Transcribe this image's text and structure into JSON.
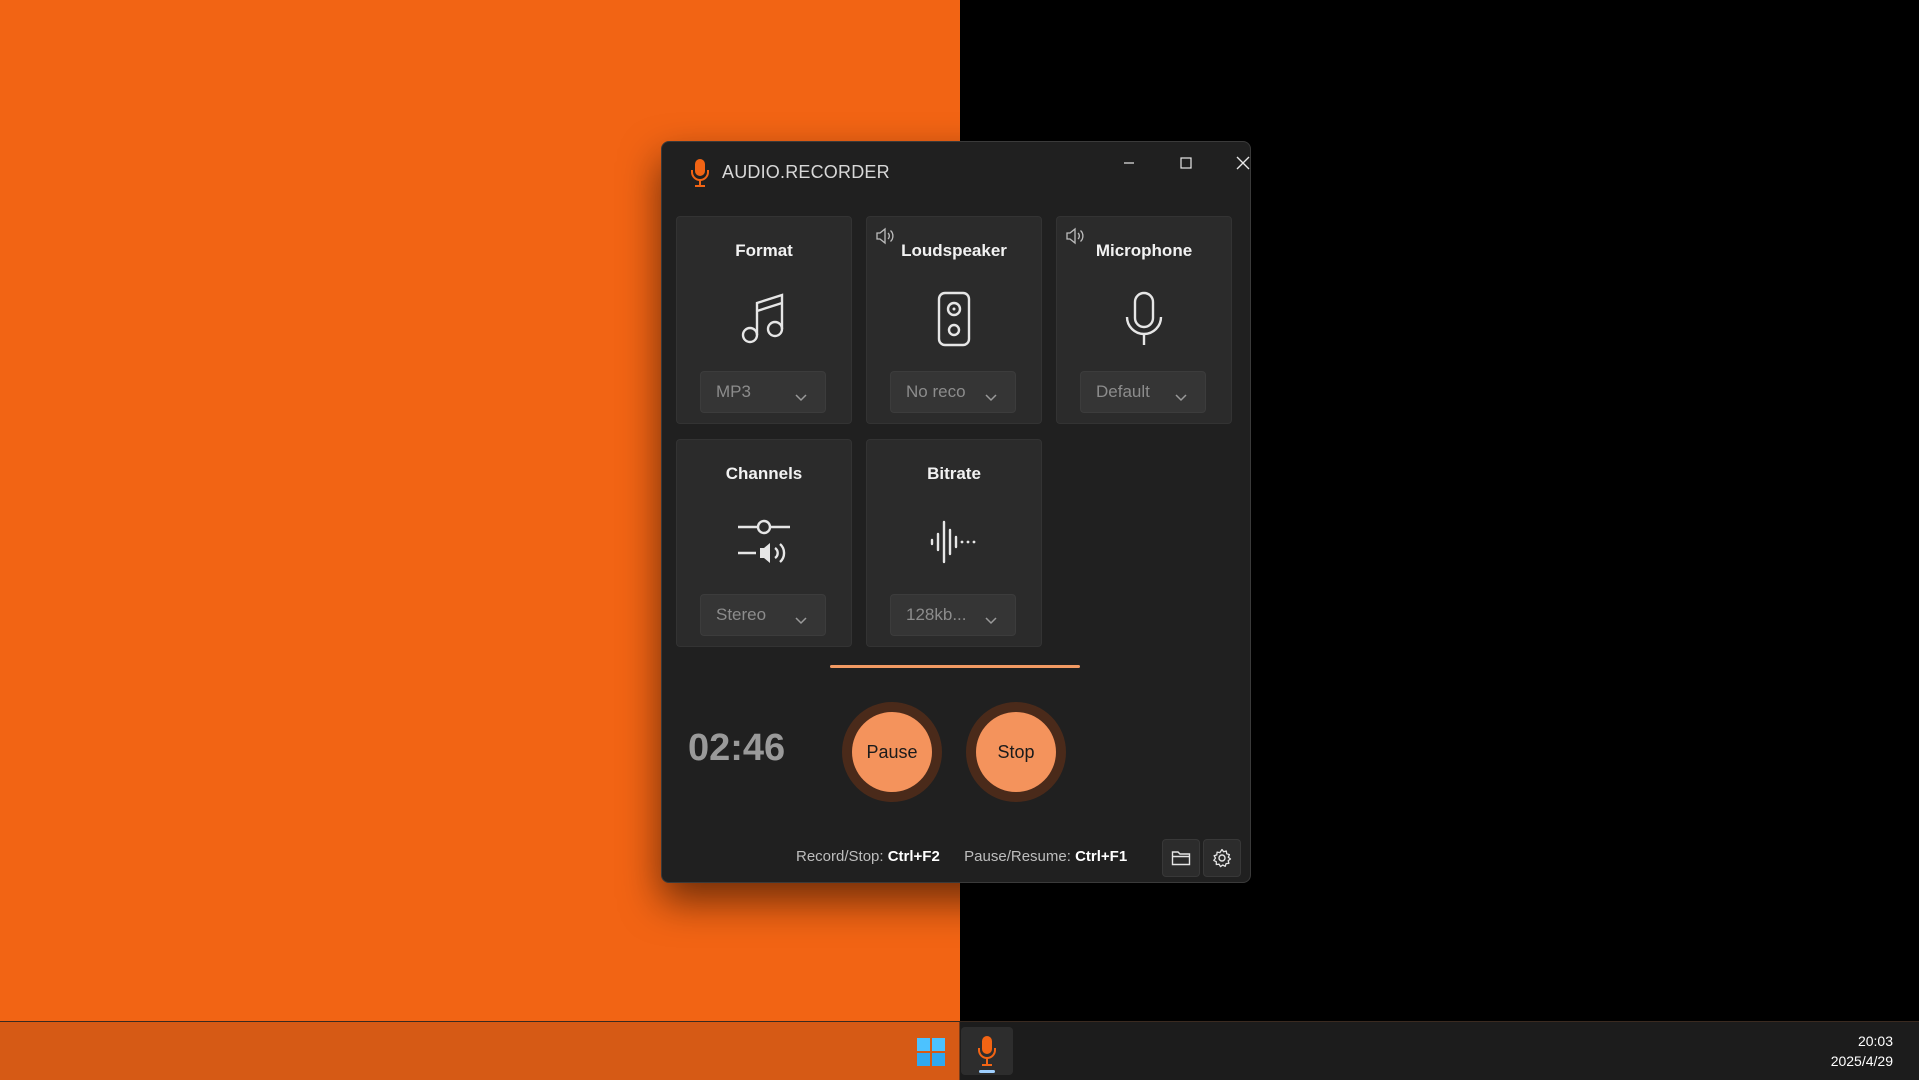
{
  "app": {
    "title": "AUDIO.RECORDER"
  },
  "window_controls": {
    "minimize": "minimize",
    "maximize": "maximize",
    "close": "close"
  },
  "cards": {
    "format": {
      "title": "Format",
      "icon": "music-note-icon",
      "value": "MP3"
    },
    "loudspeaker": {
      "title": "Loudspeaker",
      "icon": "speaker-icon",
      "value": "No reco"
    },
    "microphone": {
      "title": "Microphone",
      "icon": "microphone-icon",
      "value": "Default"
    },
    "channels": {
      "title": "Channels",
      "icon": "channels-icon",
      "value": "Stereo"
    },
    "bitrate": {
      "title": "Bitrate",
      "icon": "waveform-icon",
      "value": "128kb..."
    }
  },
  "recording": {
    "timer": "02:46",
    "pause_label": "Pause",
    "stop_label": "Stop"
  },
  "shortcuts": {
    "record_stop_label": "Record/Stop:",
    "record_stop_key": "Ctrl+F2",
    "pause_resume_label": "Pause/Resume:",
    "pause_resume_key": "Ctrl+F1"
  },
  "colors": {
    "accent": "#f4935c",
    "wallpaper": "#f26414",
    "window_bg": "#202020"
  },
  "taskbar": {
    "time": "20:03",
    "date": "2025/4/29"
  }
}
